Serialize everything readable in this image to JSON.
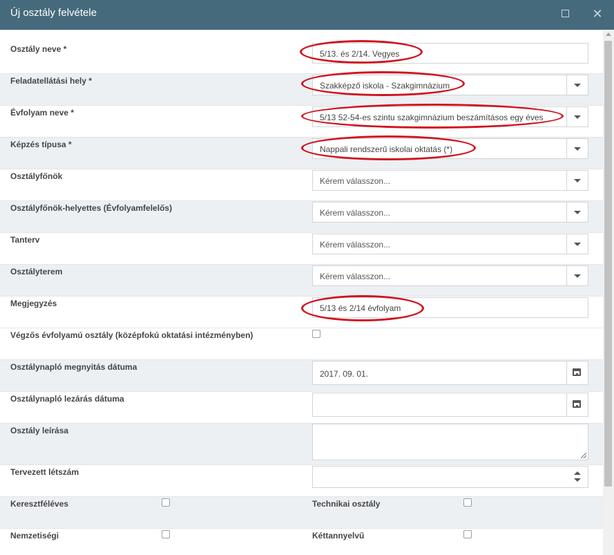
{
  "dialog": {
    "title": "Új osztály felvétele",
    "maximize_icon": "maximize-icon",
    "close_icon": "close-icon",
    "close_glyph": "✕"
  },
  "fields": {
    "osztaly_neve": {
      "label": "Osztály neve *",
      "value": "5/13. és 2/14. Vegyes"
    },
    "feladatellatasi_hely": {
      "label": "Feladatellátási hely *",
      "value": "Szakképző iskola - Szakgimnázium"
    },
    "evfolyam_neve": {
      "label": "Évfolyam neve *",
      "value": "5/13 52-54-es szintu szakgimnázium beszámításos egy éves"
    },
    "kepzes_tipusa": {
      "label": "Képzés típusa *",
      "value": "Nappali rendszerű iskolai oktatás (*)"
    },
    "osztalyfonok": {
      "label": "Osztályfőnök",
      "value": "Kérem válasszon..."
    },
    "osztalyfonok_helyettes": {
      "label": "Osztályfőnök-helyettes (Évfolyamfelelős)",
      "value": "Kérem válasszon..."
    },
    "tanterv": {
      "label": "Tanterv",
      "value": "Kérem válasszon..."
    },
    "osztalyterem": {
      "label": "Osztályterem",
      "value": "Kérem válasszon..."
    },
    "megjegyzes": {
      "label": "Megjegyzés",
      "value": "5/13 és 2/14 évfolyam"
    },
    "vegzos": {
      "label": "Végzős évfolyamú osztály (középfokú oktatási intézményben)",
      "checked": false
    },
    "naplo_megnyitas": {
      "label": "Osztálynapló megnyitás dátuma",
      "value": "2017. 09. 01."
    },
    "naplo_lezaras": {
      "label": "Osztálynapló lezárás dátuma",
      "value": ""
    },
    "leiras": {
      "label": "Osztály leírása",
      "value": ""
    },
    "tervezett_letszam": {
      "label": "Tervezett létszám",
      "value": ""
    },
    "keresztfeleves": {
      "label": "Keresztféléves",
      "checked": false
    },
    "technikai_osztaly": {
      "label": "Technikai osztály",
      "checked": false
    },
    "nemzetisegi": {
      "label": "Nemzetiségi",
      "checked": false
    },
    "kettannyelvu": {
      "label": "Kéttannyelvű",
      "checked": false
    }
  },
  "colors": {
    "titlebar": "#456a7c",
    "highlight_ellipse": "#d0141e",
    "row_alt": "#edf0f3"
  }
}
